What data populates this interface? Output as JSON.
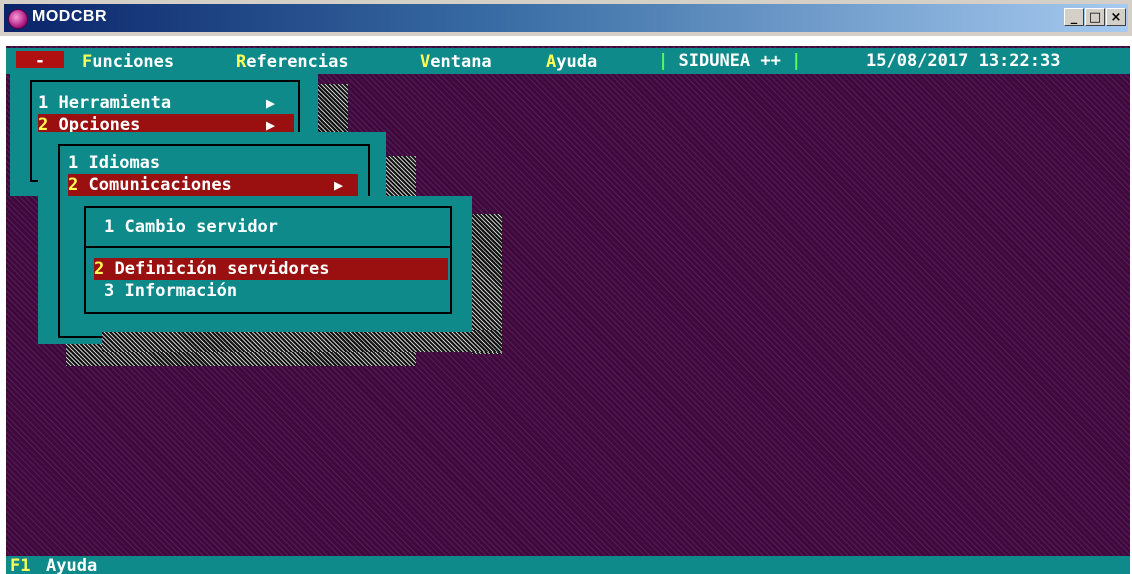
{
  "window": {
    "title": "MODCBR",
    "min_label": "_",
    "max_label": "□",
    "close_label": "×"
  },
  "menubar": {
    "system_label": "-",
    "items": [
      {
        "hotkey": "F",
        "rest": "unciones"
      },
      {
        "hotkey": "R",
        "rest": "eferencias"
      },
      {
        "hotkey": "V",
        "rest": "entana"
      },
      {
        "hotkey": "A",
        "rest": "yuda"
      }
    ],
    "app_name": "SIDUNEA ++",
    "separator": "|",
    "datetime": "15/08/2017 13:22:33"
  },
  "menu1": {
    "items": [
      {
        "num": "1",
        "label": "Herramienta",
        "submenu": true
      },
      {
        "num": "2",
        "label": "Opciones",
        "submenu": true,
        "selected": true
      }
    ]
  },
  "menu2": {
    "items": [
      {
        "num": "1",
        "label": "Idiomas",
        "submenu": false
      },
      {
        "num": "2",
        "label": "Comunicaciones",
        "submenu": true,
        "selected": true
      }
    ]
  },
  "menu3": {
    "items": [
      {
        "num": "1",
        "label": "Cambio servidor"
      },
      {
        "num": "2",
        "label": "Definición servidores",
        "selected": true
      },
      {
        "num": "3",
        "label": "Información"
      }
    ]
  },
  "statusbar": {
    "key": "F1",
    "label": "Ayuda"
  },
  "colors": {
    "terminal_bg": "#3c0a3c",
    "panel": "#0f8a8a",
    "selected": "#9a1010",
    "hotkey": "#ffff55"
  }
}
